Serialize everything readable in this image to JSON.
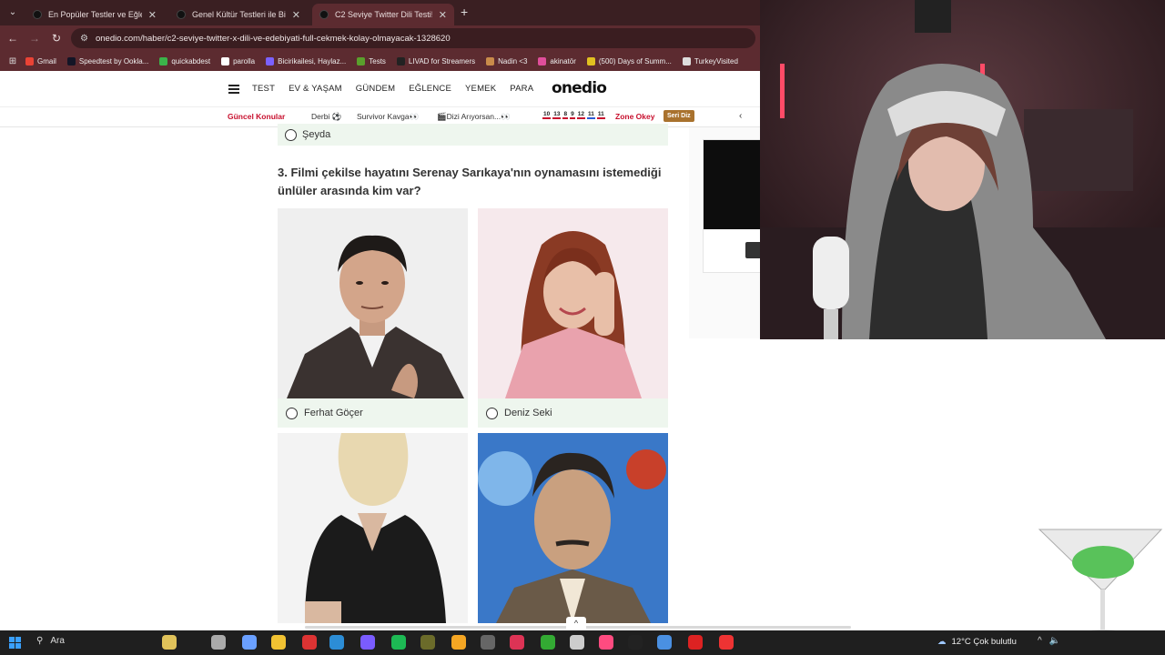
{
  "browser": {
    "tabs": [
      {
        "title": "En Popüler Testler ve Eğlenceli İ",
        "active": false
      },
      {
        "title": "Genel Kültür Testleri ile Bilgini T",
        "active": false
      },
      {
        "title": "C2 Seviye Twitter Dili Testi! - Or",
        "active": true
      }
    ],
    "url": "onedio.com/haber/c2-seviye-twitter-x-dili-ve-edebiyati-full-cekmek-kolay-olmayacak-1328620",
    "bookmarks": [
      {
        "label": "Gmail",
        "color": "#ea4335"
      },
      {
        "label": "Speedtest by Ookla...",
        "color": "#141526"
      },
      {
        "label": "quickabdest",
        "color": "#3bb34a"
      },
      {
        "label": "parolla",
        "color": "#ffffff"
      },
      {
        "label": "Bicirikailesi, Haylaz...",
        "color": "#7b61ff"
      },
      {
        "label": "Tests",
        "color": "#5aa02c"
      },
      {
        "label": "LIVAD for Streamers",
        "color": "#222222"
      },
      {
        "label": "Nadin <3",
        "color": "#c98b4a"
      },
      {
        "label": "akinatör",
        "color": "#e04e9b"
      },
      {
        "label": "(500) Days of Summ...",
        "color": "#e0c020"
      },
      {
        "label": "TurkeyVisited",
        "color": "#dddddd"
      }
    ]
  },
  "site": {
    "logo": "onedio",
    "nav": [
      "TEST",
      "EV & YAŞAM",
      "GÜNDEM",
      "EĞLENCE",
      "YEMEK",
      "PARA"
    ],
    "topics": {
      "label": "Güncel Konular",
      "items": [
        "Derbi ⚽",
        "Survivor Kavga👀",
        "🎬Dizi Arıyorsan...👀"
      ],
      "lotto": [
        "10",
        "13",
        "8",
        "9",
        "12",
        "11",
        "11"
      ],
      "zone": "Zone Okey",
      "badge": "Seri Diz",
      "chevron": "‹"
    }
  },
  "quiz": {
    "previous_option": "Şeyda",
    "question": "3. Filmi çekilse hayatını Serenay Sarıkaya'nın oynamasını istemediği ünlüler arasında kim var?",
    "options": [
      {
        "label": "Ferhat Göçer"
      },
      {
        "label": "Deniz Seki"
      },
      {
        "label": ""
      },
      {
        "label": ""
      }
    ],
    "scroll_up": "^"
  },
  "taskbar": {
    "search": "Ara",
    "weather": "12°C  Çok bulutlu"
  }
}
